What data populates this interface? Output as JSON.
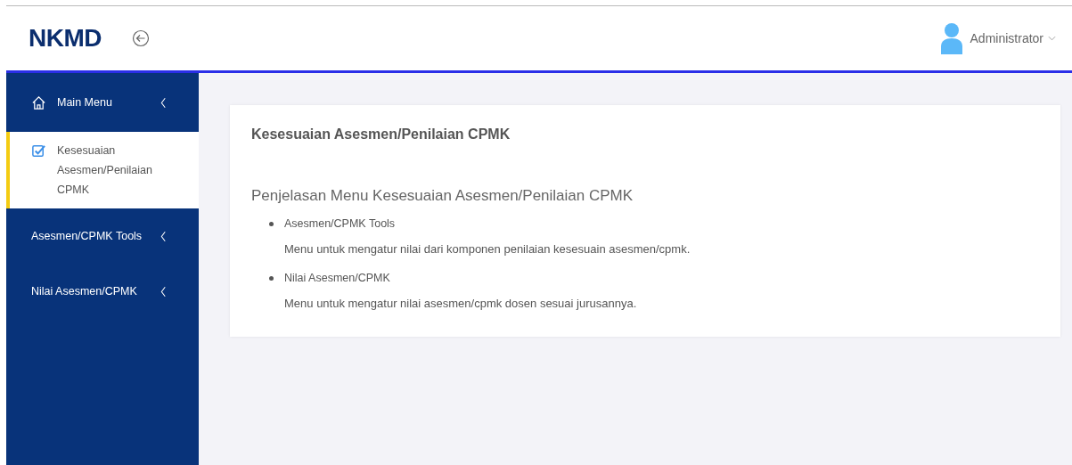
{
  "header": {
    "logo": "NKMD",
    "user": "Administrator"
  },
  "sidebar": {
    "items": [
      {
        "label": "Main Menu",
        "kind": "home",
        "selected": false,
        "expandable": true
      },
      {
        "label": "Kesesuaian Asesmen/Penilaian CPMK",
        "kind": "check",
        "selected": true,
        "expandable": false
      },
      {
        "label": "Asesmen/CPMK Tools",
        "kind": "plain",
        "selected": false,
        "expandable": true
      },
      {
        "label": "Nilai Asesmen/CPMK",
        "kind": "plain",
        "selected": false,
        "expandable": true
      }
    ]
  },
  "card": {
    "title": "Kesesuaian Asesmen/Penilaian CPMK",
    "subtitle": "Penjelasan Menu Kesesuaian Asesmen/Penilaian CPMK",
    "items": [
      {
        "name": "Asesmen/CPMK Tools",
        "description": "Menu untuk mengatur nilai dari komponen penilaian kesesuain asesmen/cpmk."
      },
      {
        "name": "Nilai Asesmen/CPMK",
        "description": "Menu untuk mengatur nilai asesmen/cpmk dosen sesuai jurusannya."
      }
    ]
  }
}
